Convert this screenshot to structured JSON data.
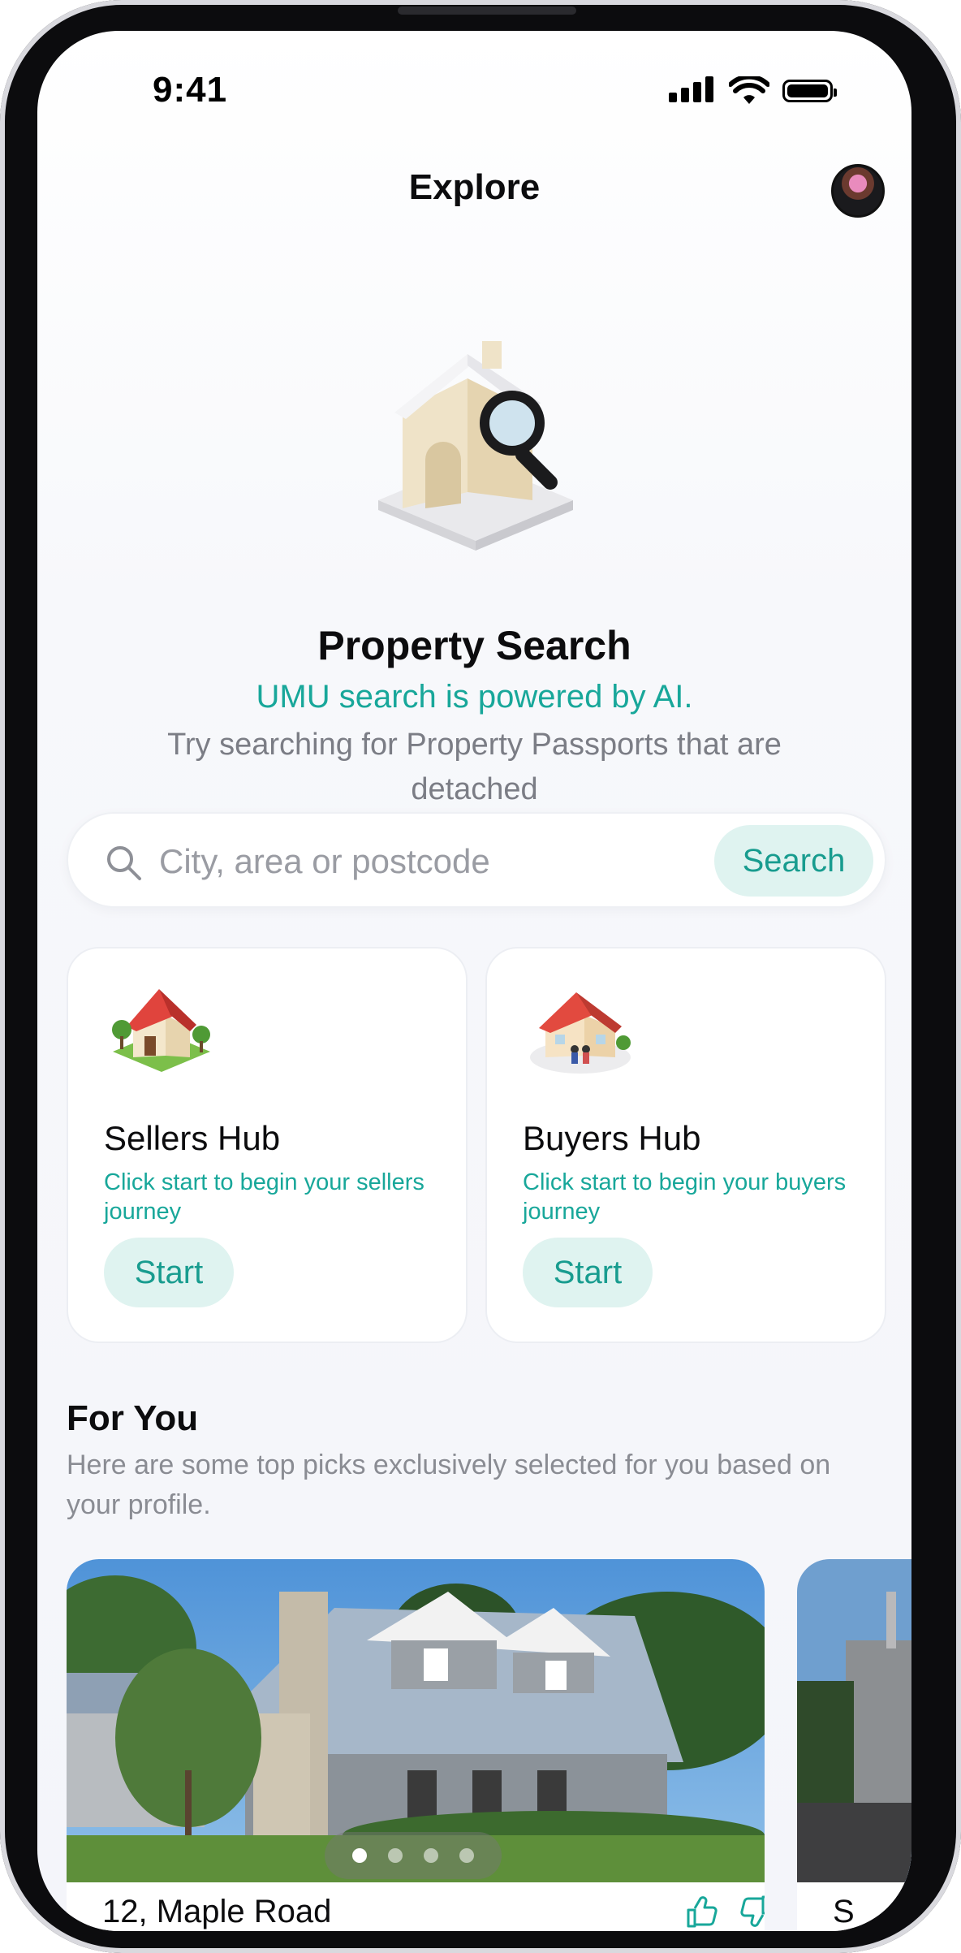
{
  "status_bar": {
    "time": "9:41"
  },
  "header": {
    "title": "Explore"
  },
  "hero": {
    "title": "Property Search",
    "tagline": "UMU search is powered by AI.",
    "hint": "Try searching for Property Passports that are detached"
  },
  "search": {
    "placeholder": "City, area or postcode",
    "value": "",
    "button_label": "Search"
  },
  "hubs": [
    {
      "title": "Sellers Hub",
      "description": "Click start to begin your sellers journey",
      "button_label": "Start"
    },
    {
      "title": "Buyers Hub",
      "description": "Click start to begin your buyers journey",
      "button_label": "Start"
    }
  ],
  "for_you": {
    "title": "For You",
    "description": "Here are some top picks exclusively selected for you based on your profile.",
    "listings": [
      {
        "address": "12, Maple Road",
        "photo_count": 4,
        "active_photo": 1
      },
      {
        "address": "S"
      }
    ]
  },
  "colors": {
    "accent": "#18a79a",
    "accent_bg": "#dff3f0",
    "muted_text": "#7b7d85"
  },
  "icons": [
    "search-icon",
    "like-icon",
    "dislike-icon",
    "avatar",
    "signal-icon",
    "wifi-icon",
    "battery-icon"
  ]
}
